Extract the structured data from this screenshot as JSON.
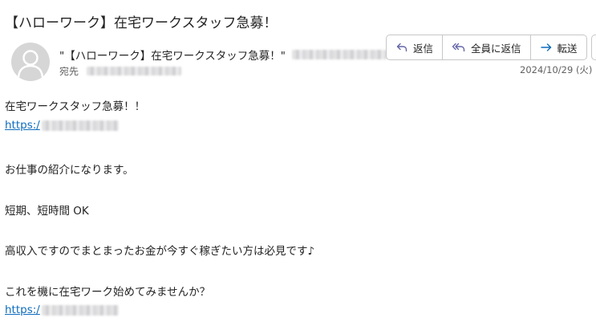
{
  "email": {
    "subject": "【ハローワーク】在宅ワークスタッフ急募！",
    "sender_name": "\"【ハローワーク】在宅ワークスタッフ急募！\"",
    "to_label": "宛先",
    "date": "2024/10/29 (火)"
  },
  "actions": {
    "reply": "返信",
    "reply_all": "全員に返信",
    "forward": "転送"
  },
  "body": {
    "line1": "在宅ワークスタッフ急募！！",
    "link1": "https:/",
    "line2": "お仕事の紹介になります。",
    "line3": "短期、短時間 OK",
    "line4": "高収入ですのでまとまったお金が今すぐ稼ぎたい方は必見です♪",
    "line5": "これを機に在宅ワーク始めてみませんか？",
    "link2": "https:/"
  },
  "colors": {
    "accent": "#0f6cbd",
    "reply_icon": "#6264a7",
    "forward_icon": "#0f6cbd",
    "avatar_bg": "#d6d6d6"
  },
  "icons": {
    "avatar": "person-icon",
    "reply": "reply-arrow-icon",
    "reply_all": "reply-all-arrow-icon",
    "forward": "forward-arrow-icon"
  }
}
